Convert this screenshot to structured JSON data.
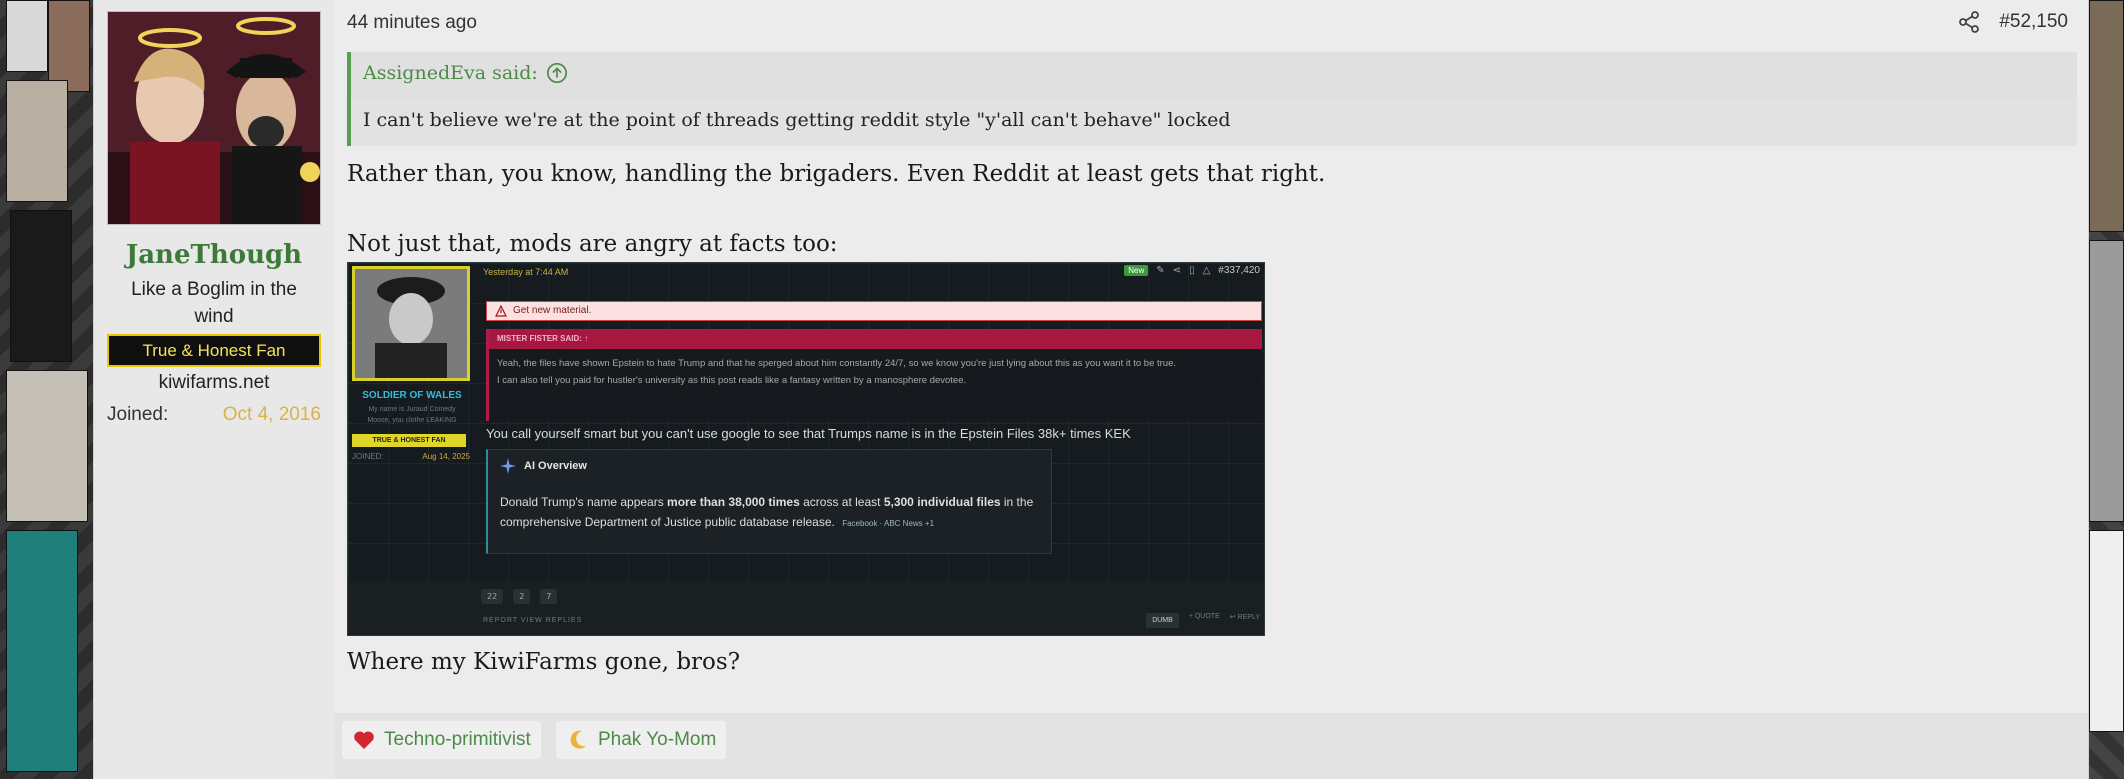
{
  "post": {
    "timestamp": "44 minutes ago",
    "post_number": "#52,150"
  },
  "user": {
    "name": "JaneThough",
    "title": "Like a Boglim in the wind",
    "banner": "True & Honest Fan",
    "site": "kiwifarms.net",
    "joined_label": "Joined:",
    "joined_value": "Oct 4, 2016"
  },
  "quote": {
    "author": "AssignedEva said:",
    "text": "I can't believe we're at the point of threads getting reddit style \"y'all can't behave\" locked"
  },
  "body": {
    "p1": "Rather than, you know, handling the brigaders. Even Reddit at least gets that right.",
    "p2": "Not just that, mods are angry at facts too:",
    "p3": "Where my KiwiFarms gone, bros?"
  },
  "embedded_screenshot": {
    "time": "Yesterday at 7:44 AM",
    "new_badge": "New",
    "post_number": "#337,420",
    "username": "SOLDIER OF WALES",
    "sub1": "My name is Juraud Comedy",
    "sub2": "Moose, you clothe LEAKING",
    "banner": "TRUE & HONEST FAN",
    "joined_label": "JOINED:",
    "joined_value": "Aug 14, 2025",
    "alert": "Get new material.",
    "quote_head": "MISTER FISTER SAID: ↑",
    "quote_line1": "Yeah, the files have shown Epstein to hate Trump and that he sperged about him constantly 24/7, so we know you're just lying about this as you want it to be true.",
    "quote_line2": "I can also tell you paid for hustler's university as this post reads like a fantasy written by a manosphere devotee.",
    "text": "You call yourself smart but you can't use google to see that Trumps name is in the Epstein Files 38k+ times KEK",
    "ai_head": "AI Overview",
    "ai_body_1": "Donald Trump's name appears ",
    "ai_bold_1": "more than 38,000 times",
    "ai_body_2": " across at least ",
    "ai_bold_2": "5,300 individual files",
    "ai_body_3": " in the comprehensive Department of Justice public database release.",
    "ai_source": "Facebook · ABC News +1",
    "react1": "22",
    "react2": "2",
    "react3": "7",
    "links": "REPORT     VIEW REPLIES",
    "dumb": "DUMB",
    "quote_btn": "+ QUOTE",
    "reply_btn": "↩ REPLY"
  },
  "reactions": [
    {
      "label": "Techno-primitivist",
      "icon": "heart-icon",
      "color": "#d22630"
    },
    {
      "label": "Phak Yo-Mom",
      "icon": "moon-icon",
      "color": "#e7b53a"
    }
  ]
}
